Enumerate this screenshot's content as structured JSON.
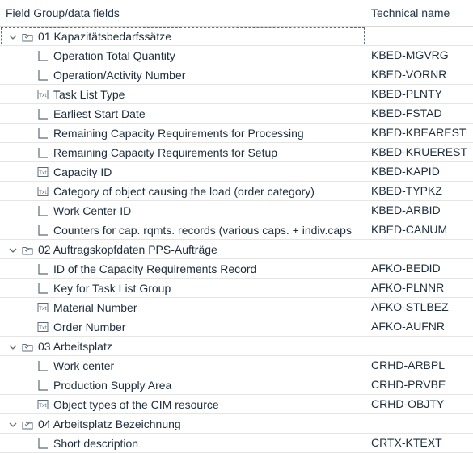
{
  "columns": {
    "field": "Field Group/data fields",
    "tech": "Technical name"
  },
  "groups": [
    {
      "label": "01 Kapazitätsbedarfssätze",
      "items": [
        {
          "label": "Operation Total Quantity",
          "tech": "KBED-MGVRG",
          "icon": "field-icon"
        },
        {
          "label": "Operation/Activity Number",
          "tech": "KBED-VORNR",
          "icon": "field-icon"
        },
        {
          "label": "Task List Type",
          "tech": "KBED-PLNTY",
          "icon": "text-field-icon"
        },
        {
          "label": "Earliest Start Date",
          "tech": "KBED-FSTAD",
          "icon": "field-icon"
        },
        {
          "label": "Remaining Capacity Requirements for Processing",
          "tech": "KBED-KBEAREST",
          "icon": "field-icon"
        },
        {
          "label": "Remaining Capacity Requirements for Setup",
          "tech": "KBED-KRUEREST",
          "icon": "field-icon"
        },
        {
          "label": "Capacity ID",
          "tech": "KBED-KAPID",
          "icon": "text-field-icon"
        },
        {
          "label": "Category of object causing the load (order category)",
          "tech": "KBED-TYPKZ",
          "icon": "text-field-icon"
        },
        {
          "label": "Work Center ID",
          "tech": "KBED-ARBID",
          "icon": "field-icon"
        },
        {
          "label": "Counters for cap. rqmts. records (various caps. + indiv.caps",
          "tech": "KBED-CANUM",
          "icon": "field-icon"
        }
      ]
    },
    {
      "label": "02 Auftragskopfdaten PPS-Aufträge",
      "items": [
        {
          "label": "ID of the Capacity Requirements Record",
          "tech": "AFKO-BEDID",
          "icon": "field-icon"
        },
        {
          "label": "Key for Task List Group",
          "tech": "AFKO-PLNNR",
          "icon": "field-icon"
        },
        {
          "label": "Material Number",
          "tech": "AFKO-STLBEZ",
          "icon": "text-field-icon"
        },
        {
          "label": "Order Number",
          "tech": "AFKO-AUFNR",
          "icon": "text-field-icon"
        }
      ]
    },
    {
      "label": "03 Arbeitsplatz",
      "items": [
        {
          "label": "Work center",
          "tech": "CRHD-ARBPL",
          "icon": "field-icon"
        },
        {
          "label": "Production Supply Area",
          "tech": "CRHD-PRVBE",
          "icon": "field-icon"
        },
        {
          "label": "Object types of the CIM resource",
          "tech": "CRHD-OBJTY",
          "icon": "text-field-icon"
        }
      ]
    },
    {
      "label": "04 Arbeitsplatz Bezeichnung",
      "items": [
        {
          "label": "Short description",
          "tech": "CRTX-KTEXT",
          "icon": "field-icon"
        }
      ]
    }
  ],
  "selected_group": 0
}
